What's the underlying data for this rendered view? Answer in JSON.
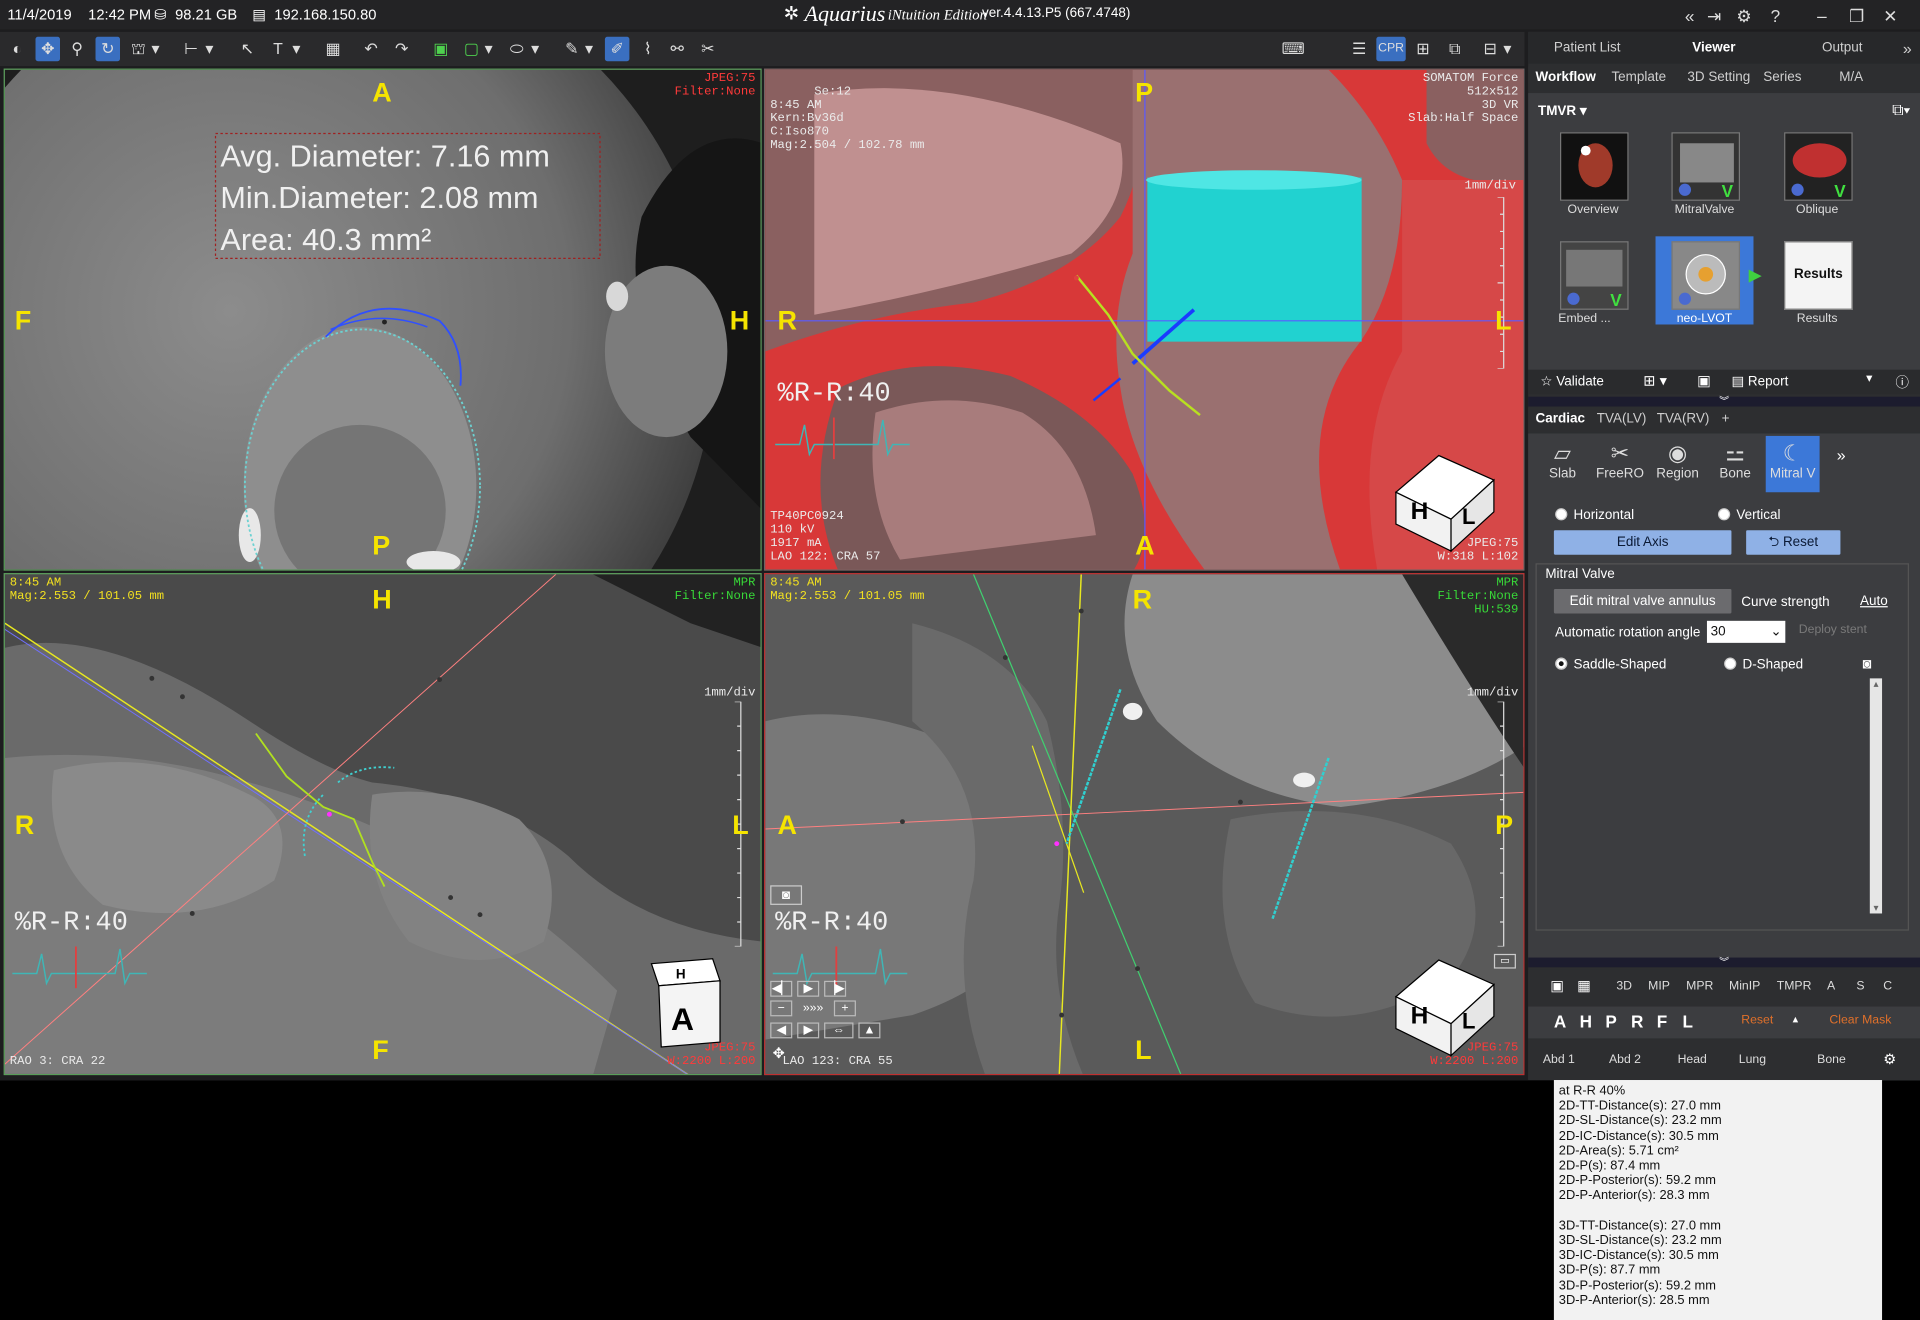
{
  "titlebar": {
    "date": "11/4/2019",
    "time": "12:42 PM",
    "disk": "98.21 GB",
    "ip": "192.168.150.80",
    "app_name": "Aquarius",
    "app_sub": "iNtuition Edition",
    "version": "ver.4.4.13.P5 (667.4748)"
  },
  "viewports": {
    "top_left": {
      "top_right": "JPEG:75\nFilter:None",
      "orient_top": "A",
      "orient_left": "F",
      "orient_right": "H",
      "orient_bottom": "P",
      "measure": [
        "Avg. Diameter: 7.16 mm",
        "Min.Diameter: 2.08 mm",
        "Area: 40.3 mm²"
      ]
    },
    "top_right": {
      "top_left": "Se:12\n8:45 AM\nKern:Bv36d\nC:Iso870\nMag:2.504 / 102.78 mm",
      "top_right": "SOMATOM Force\n512x512\n3D VR\nSlab:Half Space",
      "scale": "1mm/div",
      "bottom_left": "TP40PC0924\n110 kV\n1917 mA\nLAO 122: CRA 57",
      "bottom_right": "JPEG:75\nW:318 L:102",
      "orient_top": "P",
      "orient_left": "R",
      "orient_right": "L",
      "orient_bottom": "A",
      "ecg": "%R-R:40"
    },
    "bottom_left": {
      "top_left": "8:45 AM\nMag:2.553 / 101.05 mm",
      "top_right": "MPR\nFilter:None",
      "scale": "1mm/div",
      "bottom_left": "RAO 3: CRA 22",
      "bottom_right": "JPEG:75\nW:2200 L:200",
      "orient_top": "H",
      "orient_left": "R",
      "orient_right": "L",
      "orient_bottom": "F",
      "ecg": "%R-R:40"
    },
    "bottom_right": {
      "top_left": "8:45 AM\nMag:2.553 / 101.05 mm",
      "top_right": "MPR\nFilter:None\nHU:539",
      "scale": "1mm/div",
      "bottom_left": "LAO 123: CRA 55",
      "bottom_right": "JPEG:75\nW:2200 L:200",
      "orient_top": "R",
      "orient_left": "A",
      "orient_right": "P",
      "orient_bottom": "L",
      "ecg": "%R-R:40"
    }
  },
  "panel": {
    "top_tabs": [
      "Patient List",
      "Viewer",
      "Output"
    ],
    "sub_tabs": [
      "Workflow",
      "Template",
      "3D Setting",
      "Series",
      "M/A"
    ],
    "protocol": "TMVR",
    "thumbs": [
      "Overview",
      "MitralValve",
      "Oblique",
      "Embed",
      "neo-LVOT",
      "Results"
    ],
    "results_thumb_text": "Results",
    "validate": "Validate",
    "report": "Report",
    "cardiac_tabs": [
      "Cardiac",
      "TVA(LV)",
      "TVA(RV)",
      "+"
    ],
    "cardiac_tools": [
      "Slab",
      "FreeRO",
      "Region",
      "Bone",
      "Mitral V"
    ],
    "horizontal": "Horizontal",
    "vertical": "Vertical",
    "edit_axis": "Edit Axis",
    "reset": "Reset",
    "mitral_valve": "Mitral Valve",
    "edit_annulus": "Edit mitral valve annulus",
    "curve_strength": "Curve strength",
    "auto": "Auto",
    "auto_rotation": "Automatic rotation angle",
    "angle_value": "30",
    "deploy_stent": "Deploy stent",
    "saddle": "Saddle-Shaped",
    "dshaped": "D-Shaped",
    "results": [
      "at R-R 40%",
      "2D-TT-Distance(s): 27.0 mm",
      "2D-SL-Distance(s): 23.2 mm",
      "2D-IC-Distance(s): 30.5 mm",
      "2D-Area(s): 5.71 cm²",
      "2D-P(s): 87.4 mm",
      "2D-P-Posterior(s): 59.2 mm",
      "2D-P-Anterior(s): 28.3 mm",
      "",
      "3D-TT-Distance(s): 27.0 mm",
      "3D-SL-Distance(s): 23.2 mm",
      "3D-IC-Distance(s): 30.5 mm",
      "3D-P(s): 87.7 mm",
      "3D-P-Posterior(s): 59.2 mm",
      "3D-P-Anterior(s): 28.5 mm"
    ],
    "render_modes": [
      "3D",
      "MIP",
      "MPR",
      "MinIP",
      "TMPR",
      "A",
      "S",
      "C"
    ],
    "orient_letters": [
      "A",
      "H",
      "P",
      "R",
      "F",
      "L"
    ],
    "reset2": "Reset",
    "clear_mask": "Clear Mask",
    "presets": [
      "Abd 1",
      "Abd 2",
      "Head",
      "Lung",
      "Bone"
    ]
  }
}
